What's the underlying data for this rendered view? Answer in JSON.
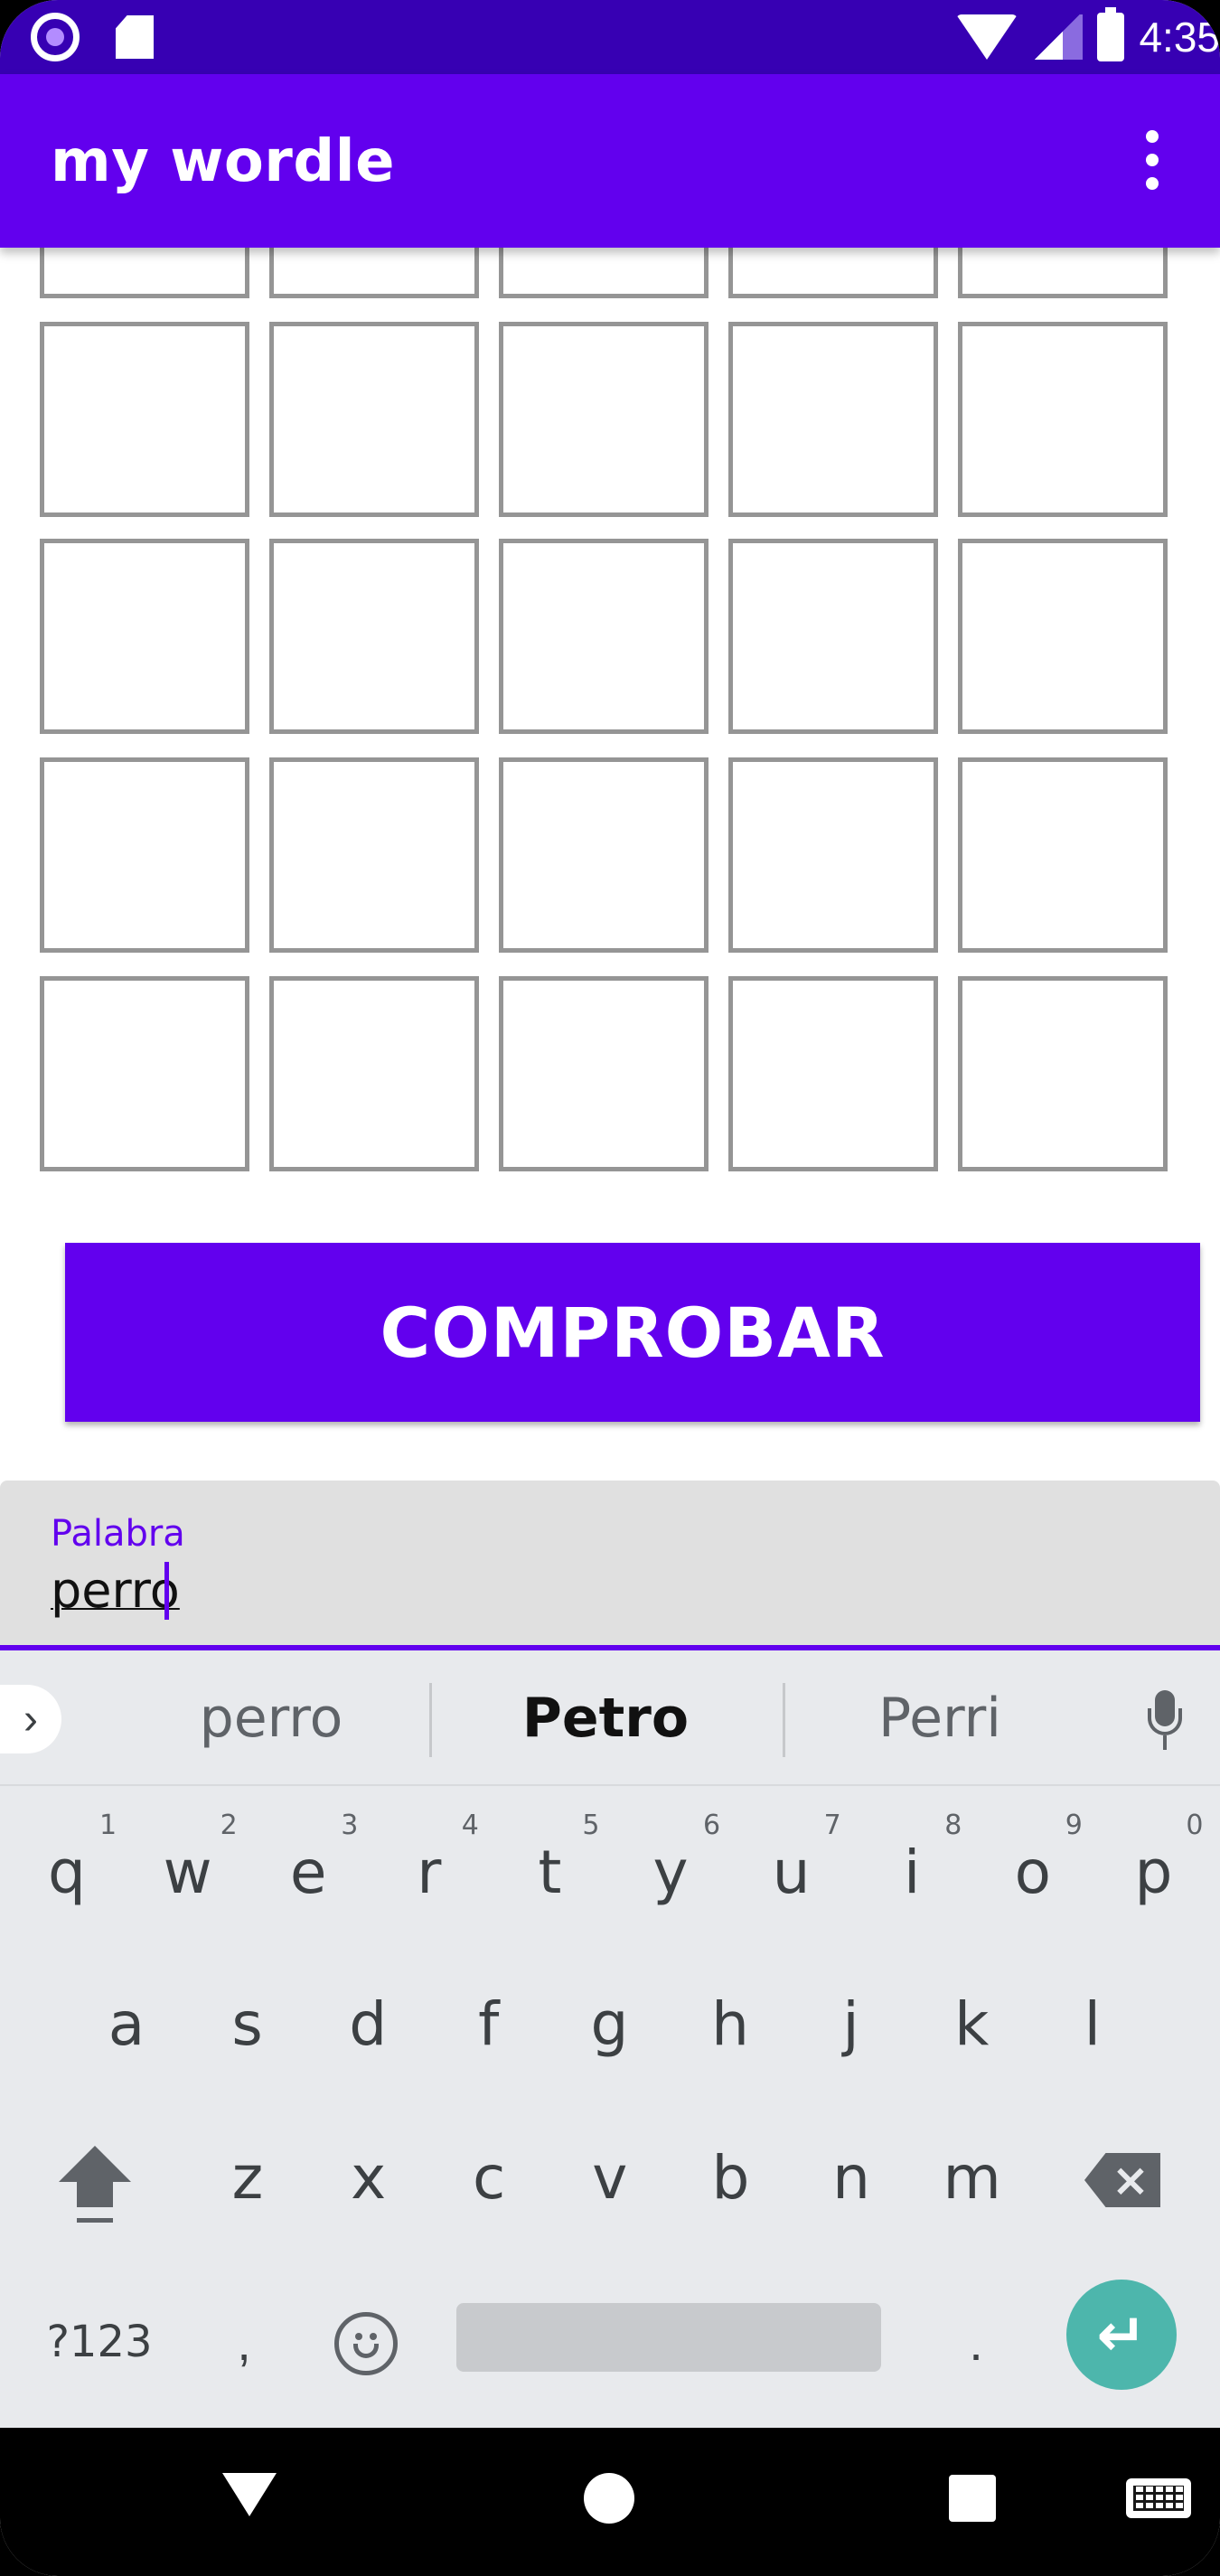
{
  "status_bar": {
    "time": "4:35"
  },
  "app_bar": {
    "title": "my wordle"
  },
  "button": {
    "label": "COMPROBAR"
  },
  "text_field": {
    "label": "Palabra",
    "value": "perro"
  },
  "keyboard": {
    "suggestions": [
      "perro",
      "Petro",
      "Perri"
    ],
    "row1": [
      "q",
      "w",
      "e",
      "r",
      "t",
      "y",
      "u",
      "i",
      "o",
      "p"
    ],
    "row1_hints": [
      "1",
      "2",
      "3",
      "4",
      "5",
      "6",
      "7",
      "8",
      "9",
      "0"
    ],
    "row2": [
      "a",
      "s",
      "d",
      "f",
      "g",
      "h",
      "j",
      "k",
      "l"
    ],
    "row3": [
      "z",
      "x",
      "c",
      "v",
      "b",
      "n",
      "m"
    ],
    "symbols_label": "?123",
    "comma": ",",
    "period": ".",
    "backspace_icon": "backspace-icon",
    "enter_icon": "enter-icon",
    "shift_icon": "shift-icon"
  },
  "nav_bar": {
    "back_icon": "back-triangle-icon",
    "home_icon": "home-circle-icon",
    "recents_icon": "recents-square-icon",
    "keyboard_icon": "keyboard-icon"
  },
  "colors": {
    "status_bar": "#3700b3",
    "primary": "#6200ee",
    "cell_border": "#959595",
    "enter_key": "#4db6ac",
    "field_bg": "#e0e0e0",
    "keyboard_bg": "#e8eaed"
  }
}
